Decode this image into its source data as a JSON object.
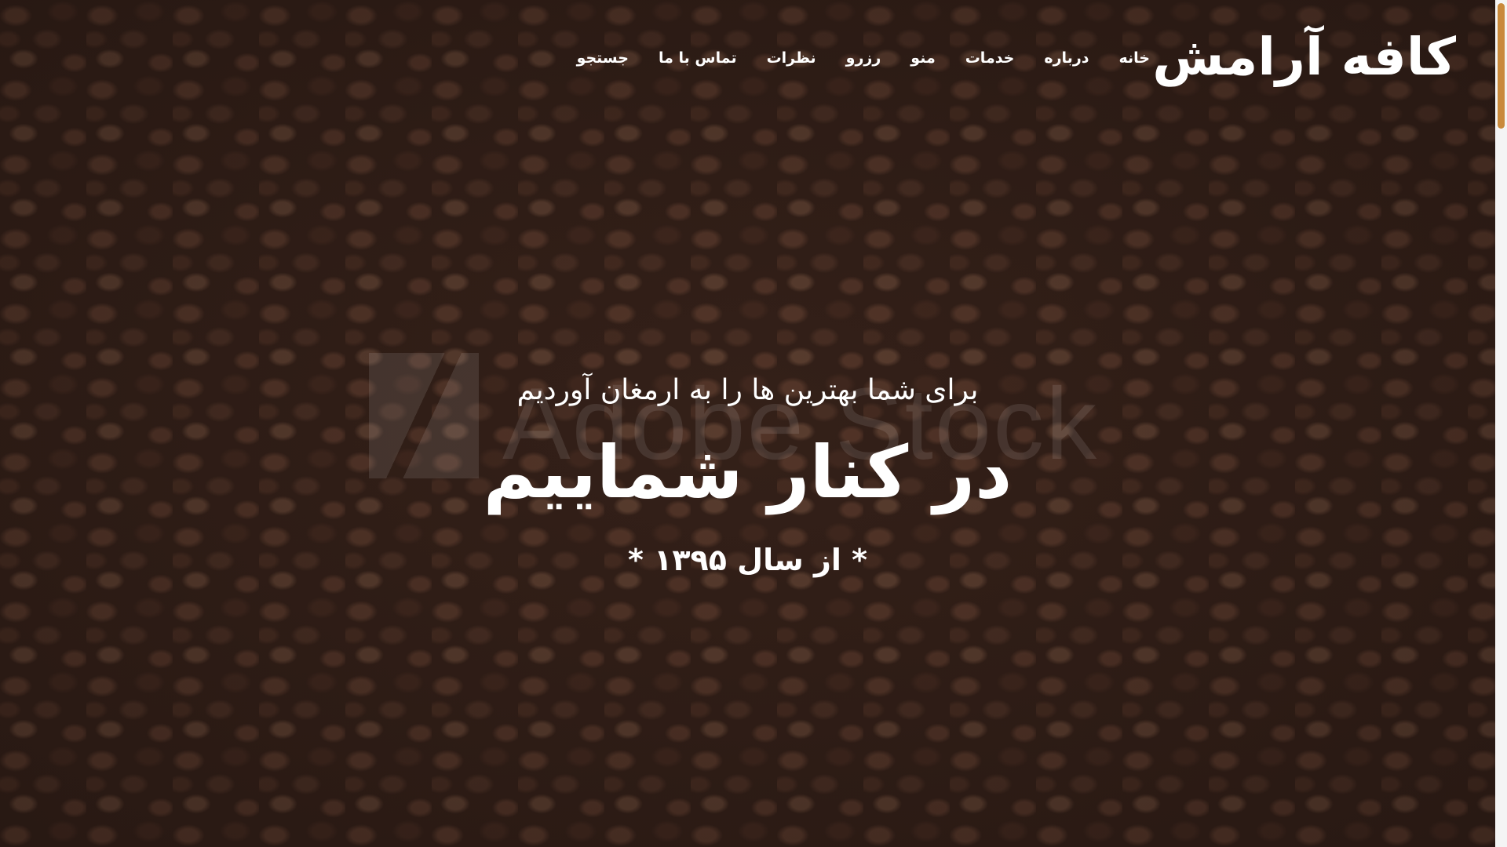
{
  "header": {
    "logo": "کافه آرامش",
    "nav": [
      "خانه",
      "درباره",
      "خدمات",
      "منو",
      "رزرو",
      "نظرات",
      "تماس با ما",
      "جستجو"
    ]
  },
  "hero": {
    "subtitle": "برای شما بهترین ها را به ارمغان آوردیم",
    "title": "در کنار شماییم",
    "since": "* از سال ۱۳۹۵ *",
    "watermark": "Adobe Stock"
  },
  "colors": {
    "accent": "#c98a3c",
    "text": "#ffffff",
    "background": "#3a241b"
  }
}
